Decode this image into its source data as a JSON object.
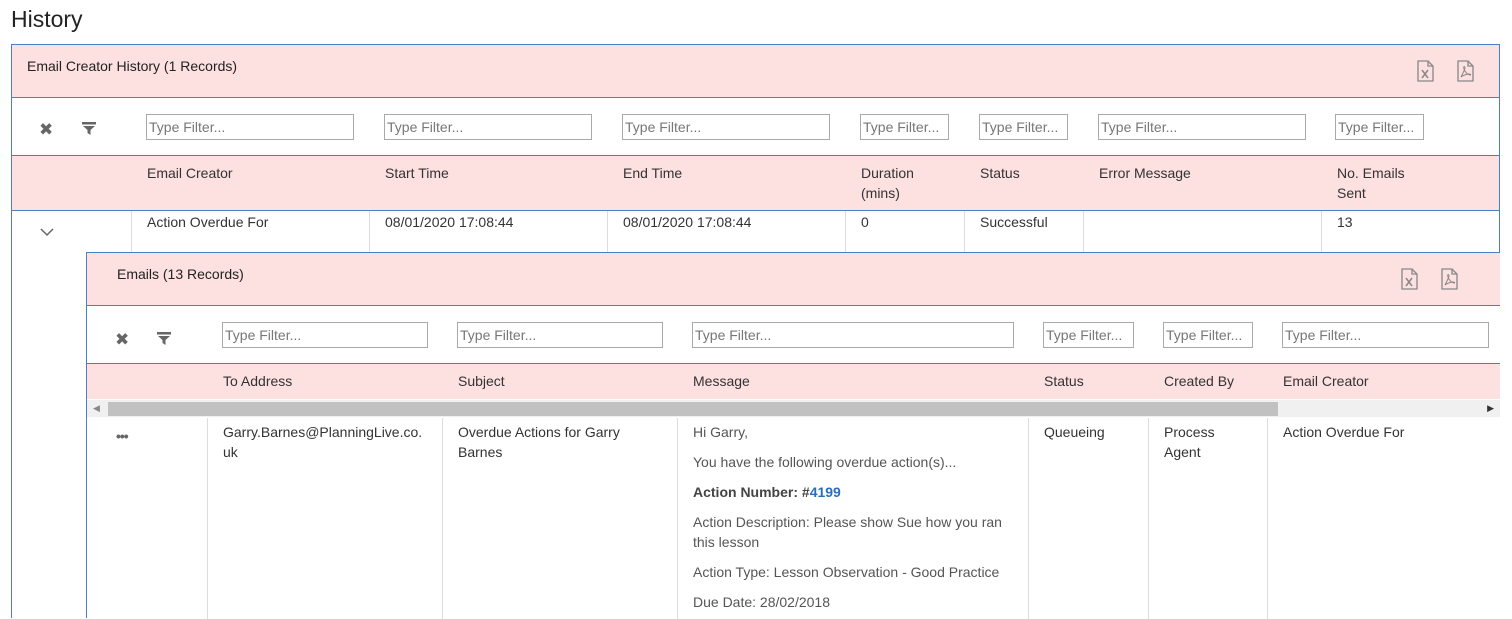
{
  "page_title": "History",
  "outer_grid": {
    "caption": "Email Creator History (1 Records)",
    "filter_placeholder": "Type Filter...",
    "columns": [
      "Email Creator",
      "Start Time",
      "End Time",
      "Duration (mins)",
      "Status",
      "Error Message",
      "No. Emails Sent"
    ],
    "row": {
      "email_creator": "Action Overdue For",
      "start_time": "08/01/2020 17:08:44",
      "end_time": "08/01/2020 17:08:44",
      "duration": "0",
      "status": "Successful",
      "error_message": "",
      "emails_sent": "13"
    }
  },
  "inner_grid": {
    "caption": "Emails (13 Records)",
    "filter_placeholder": "Type Filter...",
    "columns": [
      "To Address",
      "Subject",
      "Message",
      "Status",
      "Created By",
      "Email Creator"
    ],
    "row": {
      "to_address": "Garry.Barnes@PlanningLive.co.uk",
      "subject": "Overdue Actions for Garry Barnes",
      "message": {
        "greeting": "Hi Garry,",
        "intro": "You have the following overdue action(s)...",
        "action_number_label": "Action Number: #",
        "action_number": "4199",
        "description": "Action Description: Please show Sue how you ran this lesson",
        "type": "Action Type: Lesson Observation - Good Practice",
        "due_date": "Due Date: 28/02/2018"
      },
      "status": "Queueing",
      "created_by": "Process Agent",
      "email_creator": "Action Overdue For"
    }
  },
  "colors": {
    "header_bg": "#fde0e0",
    "border": "#4a7fc1",
    "link": "#2a6ebb"
  }
}
